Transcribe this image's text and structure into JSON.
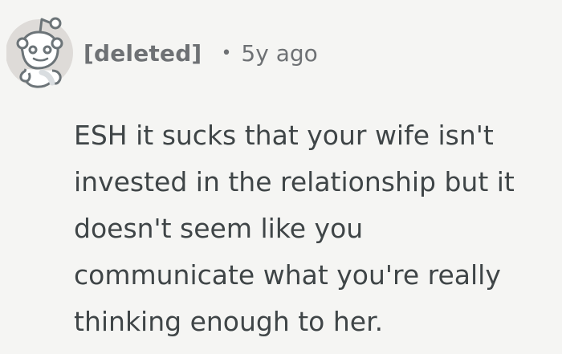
{
  "comment": {
    "author": "[deleted]",
    "separator": "•",
    "timestamp": "5y ago",
    "body_lines": [
      "ESH it sucks that your wife isn't",
      "invested in the relationship but it",
      "doesn't seem like you",
      "communicate what you're really",
      "thinking enough to her."
    ]
  },
  "avatar": {
    "icon": "reddit-snoo-avatar-icon",
    "colors": {
      "background": "#dedbd8",
      "outline": "#6c7478",
      "fill": "#ffffff",
      "shadow": "#d9dde0"
    }
  },
  "theme": {
    "background": "#f5f5f3",
    "meta_text": "#6e7174",
    "body_text": "#3f4547"
  }
}
